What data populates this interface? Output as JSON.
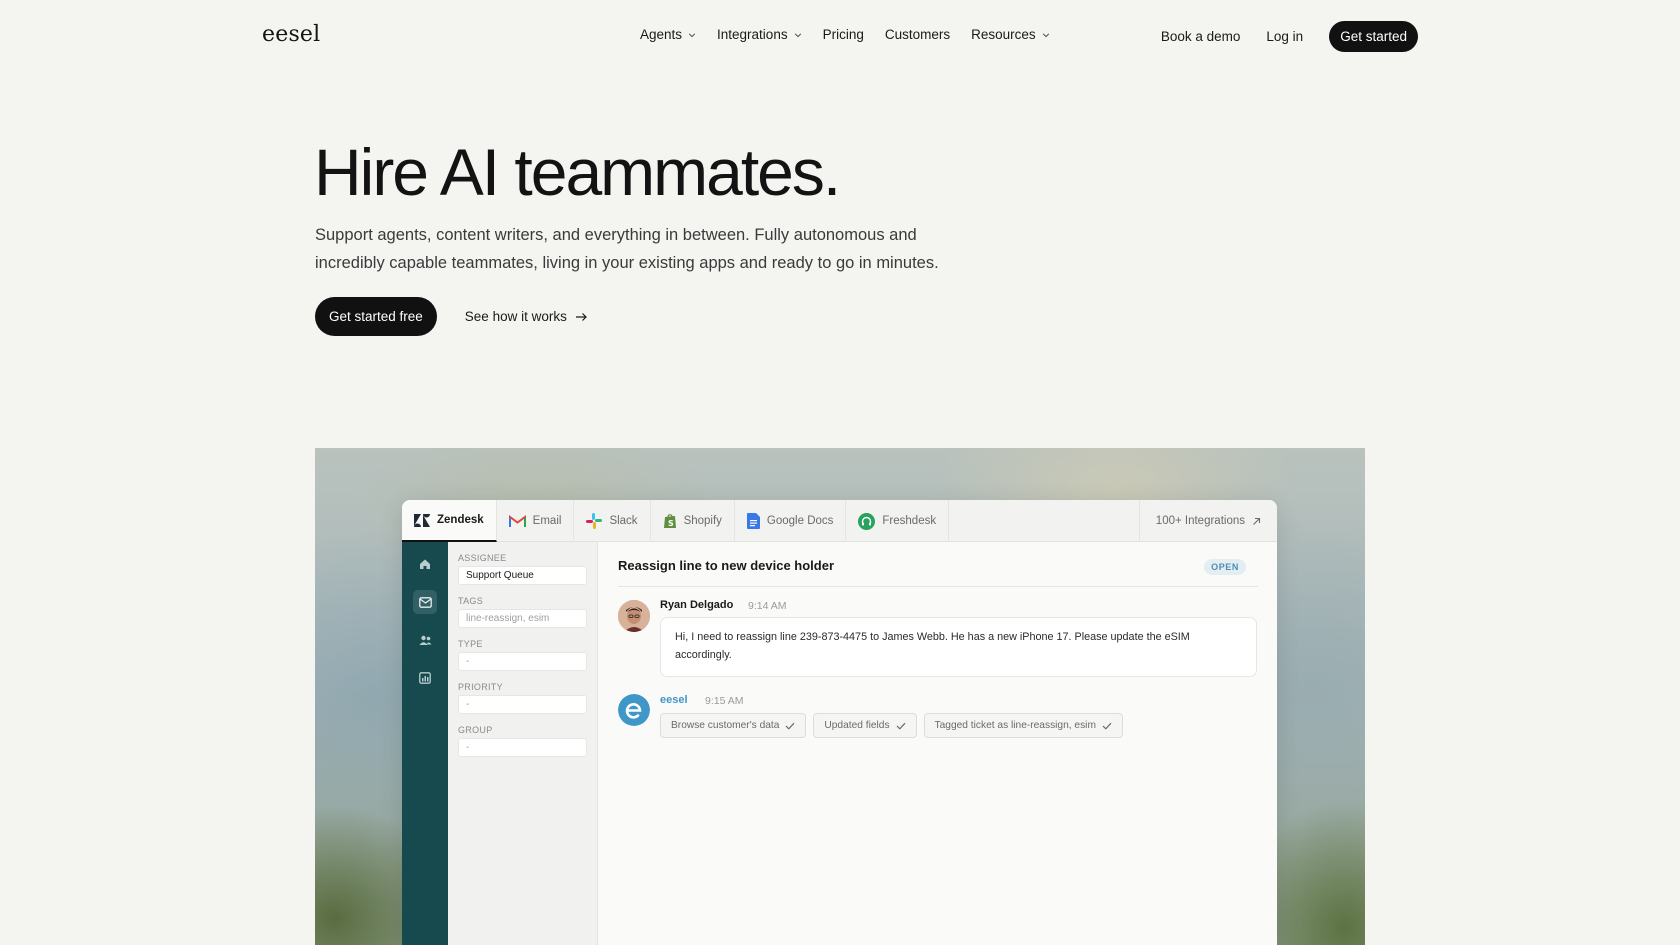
{
  "header": {
    "logo": "eesel",
    "nav": [
      {
        "label": "Agents",
        "has_dropdown": true
      },
      {
        "label": "Integrations",
        "has_dropdown": true
      },
      {
        "label": "Pricing",
        "has_dropdown": false
      },
      {
        "label": "Customers",
        "has_dropdown": false
      },
      {
        "label": "Resources",
        "has_dropdown": true
      }
    ],
    "book_demo": "Book a demo",
    "login": "Log in",
    "get_started": "Get started"
  },
  "hero": {
    "title": "Hire AI teammates.",
    "subtitle_line1": "Support agents, content writers, and everything in between. Fully autonomous and",
    "subtitle_line2": "incredibly capable teammates, living in your existing apps and ready to go in minutes.",
    "cta_primary": "Get started free",
    "cta_secondary": "See how it works",
    "cta_secondary_icon": "arrow-right-icon"
  },
  "app": {
    "tabs": [
      {
        "label": "Zendesk",
        "icon": "zendesk-icon",
        "active": true
      },
      {
        "label": "Email",
        "icon": "gmail-icon",
        "active": false
      },
      {
        "label": "Slack",
        "icon": "slack-icon",
        "active": false
      },
      {
        "label": "Shopify",
        "icon": "shopify-icon",
        "active": false
      },
      {
        "label": "Google Docs",
        "icon": "google-docs-icon",
        "active": false
      },
      {
        "label": "Freshdesk",
        "icon": "freshdesk-icon",
        "active": false
      }
    ],
    "integrations_link": "100+ Integrations",
    "rail_icons": [
      "home-icon",
      "inbox-icon",
      "users-icon",
      "reports-icon"
    ],
    "fields": {
      "assignee_label": "ASSIGNEE",
      "assignee_value": "Support Queue",
      "tags_label": "TAGS",
      "tags_value": "line-reassign, esim",
      "type_label": "TYPE",
      "type_value": "-",
      "priority_label": "PRIORITY",
      "priority_value": "-",
      "group_label": "GROUP",
      "group_value": "-"
    },
    "ticket": {
      "subject": "Reassign line to new device holder",
      "status": "OPEN",
      "customer_name": "Ryan Delgado",
      "customer_time": "9:14 AM",
      "customer_msg_line1": "Hi, I need to reassign line 239-873-4475 to James Webb. He has a new iPhone 17. Please update the eSIM",
      "customer_msg_line2": "accordingly.",
      "agent_name": "eesel",
      "agent_time": "9:15 AM",
      "actions": [
        "Browse customer's data",
        "Updated fields",
        "Tagged ticket as line-reassign, esim"
      ]
    }
  },
  "colors": {
    "accent_dark": "#111111",
    "rail_teal": "#174a4f",
    "eesel_blue": "#3f97c8",
    "open_badge": "#4f8fb0"
  }
}
